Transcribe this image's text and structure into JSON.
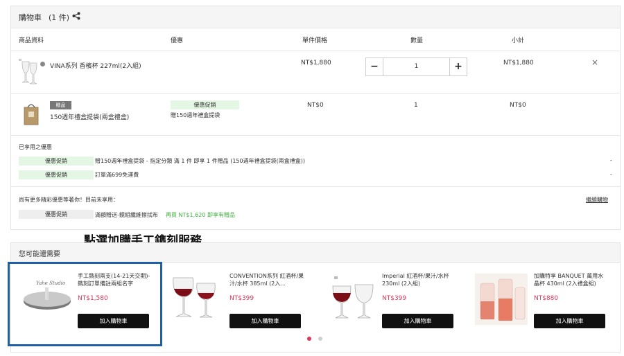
{
  "cart": {
    "title": "購物車",
    "count": "(1 件)",
    "columns": {
      "product": "商品資料",
      "promo": "優惠",
      "unit_price": "單件價格",
      "qty": "數量",
      "subtotal": "小計"
    },
    "items": [
      {
        "name": "VINA系列 香檳杯 227ml(2入組)",
        "price": "NT$1,880",
        "qty": "1",
        "subtotal": "NT$1,880",
        "qty_minus": "−",
        "qty_plus": "+",
        "remove": "×"
      },
      {
        "badge": "贈品",
        "name": "150週年禮盒提袋(兩盒禮盒)",
        "promo_tag": "優惠促銷",
        "promo_text": "贈150週年禮盒提袋",
        "price": "NT$0",
        "qty": "1",
        "subtotal": "NT$0"
      }
    ]
  },
  "applied": {
    "heading": "已享用之優惠",
    "rows": [
      {
        "tag": "優惠促銷",
        "text": "贈150週年禮盒提袋 - 指定分類 滿 1 件 即享 1 件贈品 (150週年禮盒提袋(兩盒禮盒))",
        "value": "-"
      },
      {
        "tag": "優惠促銷",
        "text": "訂單滿699免運費",
        "value": "-"
      }
    ]
  },
  "more": {
    "heading": "尚有更多精彩優惠等著你！目前未享用：",
    "continue_link": "繼續購物",
    "rows": [
      {
        "tag": "優惠促銷",
        "text": "滿額贈送-鏡組纖維擦拭布",
        "highlight": "再買 NT$1,620 即享有贈品"
      }
    ]
  },
  "annotation": "點選加購手工鐫刻服務",
  "suggest": {
    "heading": "您可能還需要",
    "products": [
      {
        "title": "手工鐫刻兩支(14-21天交期)-鐫刻訂單備註兩組名字",
        "price": "NT$1,580",
        "button": "加入購物車",
        "logo": "Yahe Studio"
      },
      {
        "title": "CONVENTION系列 紅酒杯/果汁/水杯 385ml (2入...",
        "price": "NT$399",
        "button": "加入購物車"
      },
      {
        "title": "Imperial 紅酒杯/果汁/水杯 230ml (2入組)",
        "price": "NT$399",
        "button": "加入購物車"
      },
      {
        "title": "加購特享 BANQUET 萬用水晶杯 430ml (2入禮盒組)",
        "price": "NT$880",
        "button": "加入購物車"
      }
    ]
  },
  "colors": {
    "accent_red": "#d9385a",
    "promo_green": "#e4f7e4",
    "highlight_green": "#3fae3f",
    "annotation_blue": "#1f5fa8"
  }
}
